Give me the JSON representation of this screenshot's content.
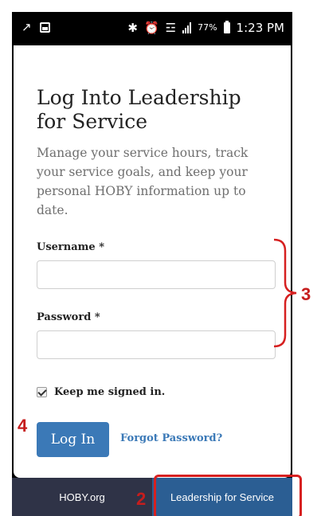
{
  "status_bar": {
    "battery": "77%",
    "time": "1:23 PM"
  },
  "login": {
    "title": "Log Into Leadership for Service",
    "subtitle": "Manage your service hours, track your service goals, and keep your personal HOBY information up to date.",
    "username_label": "Username *",
    "username_value": "",
    "password_label": "Password *",
    "password_value": "",
    "remember_label": "Keep me signed in.",
    "remember_checked": true,
    "login_button": "Log In",
    "forgot_link": "Forgot Password?"
  },
  "bottom_nav": {
    "items": [
      {
        "label": "HOBY.org",
        "active": false
      },
      {
        "label": "Leadership for Service",
        "active": true
      }
    ]
  },
  "annotations": {
    "nav_marker": "2",
    "fields_marker": "3",
    "login_marker": "4",
    "color": "#d62020"
  },
  "colors": {
    "primary_button": "#3b79b7",
    "nav_background": "#2f3347",
    "nav_active": "#2b5e93"
  }
}
